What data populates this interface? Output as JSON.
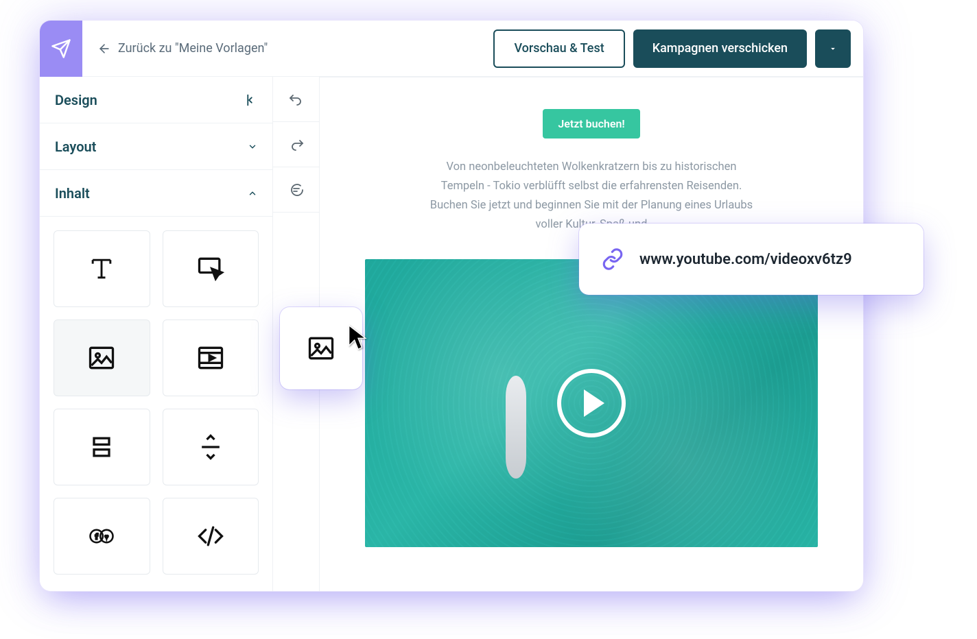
{
  "header": {
    "back_label": "Zurück zu \"Meine Vorlagen\"",
    "preview_label": "Vorschau & Test",
    "send_label": "Kampagnen verschicken"
  },
  "sidebar": {
    "sections": {
      "design": "Design",
      "layout": "Layout",
      "content": "Inhalt"
    },
    "blocks": [
      {
        "name": "text"
      },
      {
        "name": "button-click"
      },
      {
        "name": "image"
      },
      {
        "name": "video"
      },
      {
        "name": "columns"
      },
      {
        "name": "divider"
      },
      {
        "name": "social"
      },
      {
        "name": "html"
      }
    ]
  },
  "canvas": {
    "cta_label": "Jetzt buchen!",
    "blurb_line1": "Von neonbeleuchteten Wolkenkratzern bis zu historischen",
    "blurb_line2": "Tempeln - Tokio verblüfft selbst die erfahrensten Reisenden.",
    "blurb_line3": "Buchen Sie jetzt und beginnen Sie mit der Planung eines Urlaubs",
    "blurb_line4": "voller Kultur, Spaß und"
  },
  "popover": {
    "url": "www.youtube.com/videoxv6tz9"
  }
}
